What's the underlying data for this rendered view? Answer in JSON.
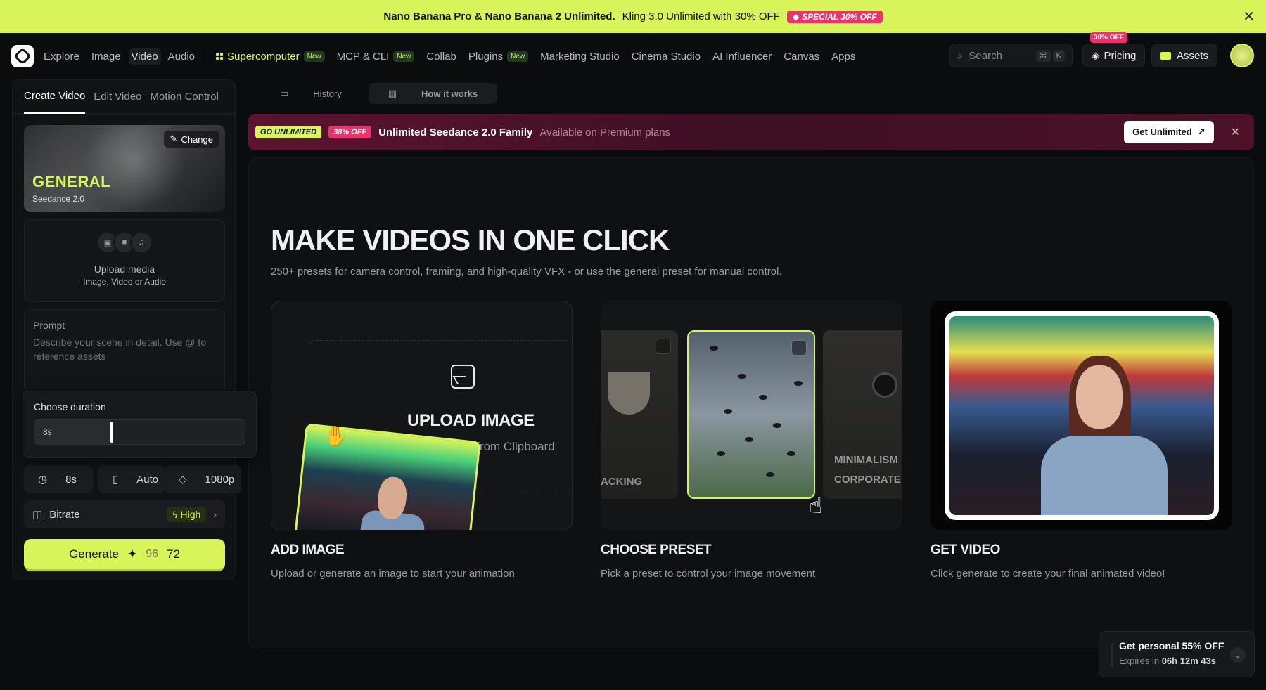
{
  "promo": {
    "text_bold": "Nano Banana Pro & Nano Banana 2 Unlimited.",
    "text_rest": "Kling 3.0 Unlimited with 30% OFF",
    "badge": "SPECIAL 30% OFF",
    "close": "✕"
  },
  "nav": {
    "items": [
      "Explore",
      "Image",
      "Video",
      "Audio"
    ],
    "supercomputer": "Supercomputer",
    "new": "New",
    "mcp": "MCP & CLI",
    "collab": "Collab",
    "plugins": "Plugins",
    "marketing": "Marketing Studio",
    "cinema": "Cinema Studio",
    "influencer": "AI Influencer",
    "canvas": "Canvas",
    "apps": "Apps",
    "search": "Search",
    "kbd_cmd": "⌘",
    "kbd_k": "K",
    "pricing": "Pricing",
    "pricing_badge": "30% OFF",
    "assets": "Assets"
  },
  "left": {
    "tabs": [
      "Create Video",
      "Edit Video",
      "Motion Control"
    ],
    "preset_title": "GENERAL",
    "preset_sub": "Seedance 2.0",
    "change": "Change",
    "upload_title": "Upload media",
    "upload_sub": "Image, Video or Audio",
    "prompt_label": "Prompt",
    "prompt_placeholder": "Describe your scene in detail. Use @ to reference assets",
    "duration_label": "Choose duration",
    "duration_value": "8s",
    "duration_opt": "8s",
    "aspect_opt": "Auto",
    "res_opt": "1080p",
    "bitrate_label": "Bitrate",
    "bitrate_value": "High",
    "generate": "Generate",
    "cost_old": "96",
    "cost_new": "72"
  },
  "right": {
    "tabs": [
      "History",
      "How it works"
    ],
    "banner_go": "GO UNLIMITED",
    "banner_off": "30% OFF",
    "banner_title": "Unlimited Seedance 2.0 Family",
    "banner_sub": "Available on Premium plans",
    "banner_cta": "Get Unlimited",
    "headline": "MAKE VIDEOS IN ONE CLICK",
    "subline": "250+ presets for camera control, framing, and high-quality VFX - or use the general preset for manual control.",
    "upload_image": "UPLOAD IMAGE",
    "paste": "Paste from Clipboard",
    "preset_label_1": "ACKING",
    "preset_label_2": "MINIMALISM",
    "preset_label_3": "CORPORATE",
    "cards": [
      {
        "title": "ADD IMAGE",
        "desc": "Upload or generate an image to start your animation"
      },
      {
        "title": "CHOOSE PRESET",
        "desc": "Pick a preset to control your image movement"
      },
      {
        "title": "GET VIDEO",
        "desc": "Click generate to create your final animated video!"
      }
    ]
  },
  "offer": {
    "title": "Get personal 55% OFF",
    "expires": "Expires in",
    "time": "06h 12m 43s"
  },
  "colors": {
    "accent": "#d8f45a",
    "pink": "#e8336b",
    "background": "#0b0c0e"
  }
}
